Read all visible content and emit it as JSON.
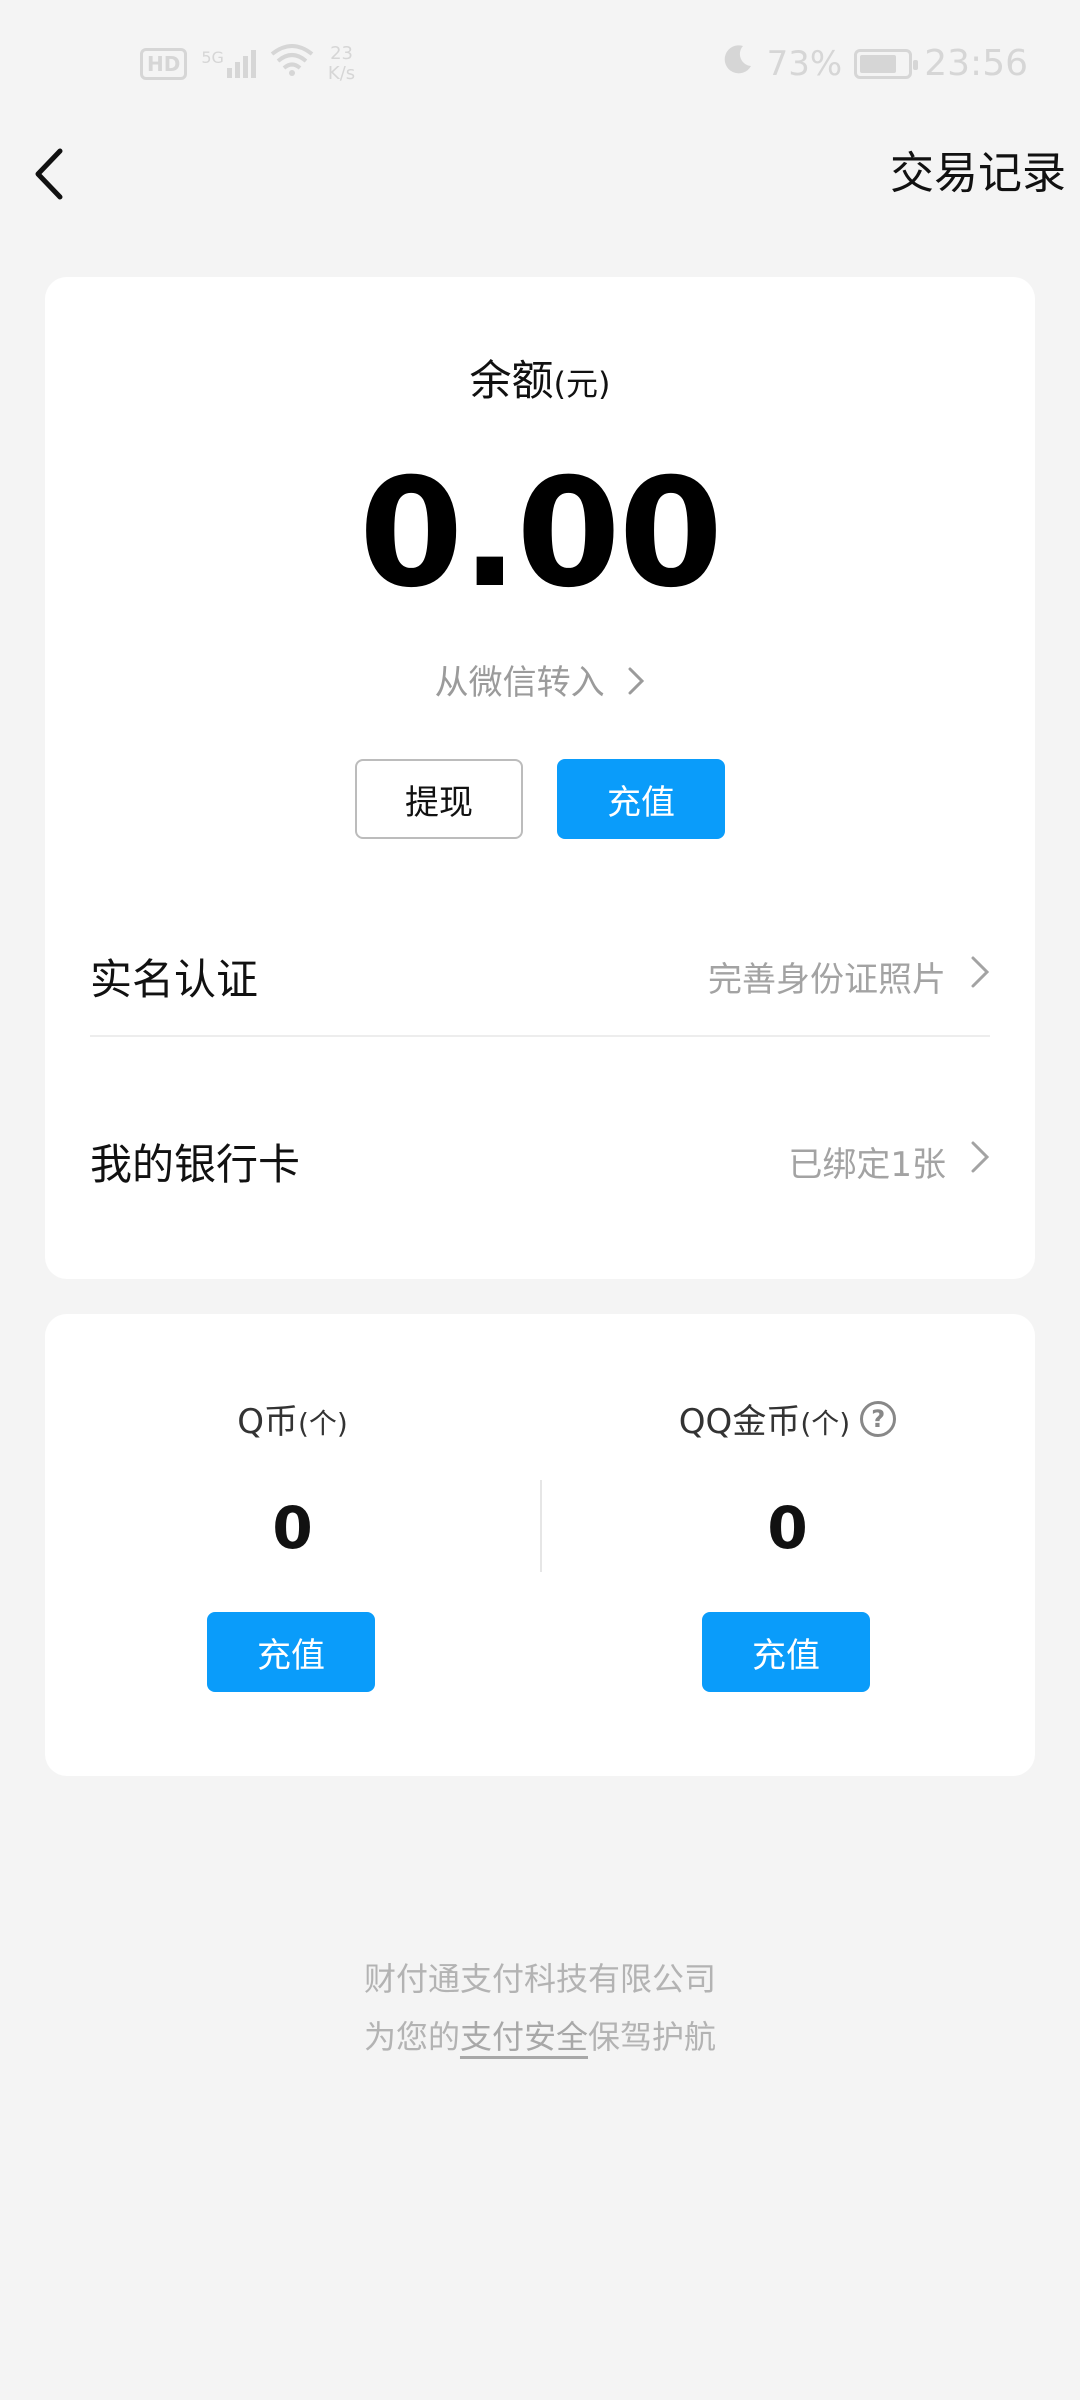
{
  "status_bar": {
    "hd": "HD",
    "signal": "5G",
    "net_speed_value": "23",
    "net_speed_unit": "K/s",
    "battery": "73%",
    "time": "23:56"
  },
  "nav": {
    "right_action": "交易记录"
  },
  "balance": {
    "label": "余额",
    "unit": "(元)",
    "value": "0.00",
    "transfer_link": "从微信转入",
    "withdraw_label": "提现",
    "recharge_label": "充值"
  },
  "rows": {
    "id_verify": {
      "label": "实名认证",
      "value": "完善身份证照片"
    },
    "bank_card": {
      "label": "我的银行卡",
      "value": "已绑定1张"
    }
  },
  "coins": {
    "qcoin": {
      "label": "Q币",
      "unit": "(个)",
      "value": "0",
      "button": "充值"
    },
    "qqgold": {
      "label": "QQ金币",
      "unit": "(个)",
      "value": "0",
      "button": "充值"
    }
  },
  "footer": {
    "line1": "财付通支付科技有限公司",
    "line2_prefix": "为您的",
    "line2_link": "支付安全",
    "line2_suffix": "保驾护航"
  },
  "colors": {
    "primary": "#0a9cfa",
    "background": "#f4f4f4"
  }
}
